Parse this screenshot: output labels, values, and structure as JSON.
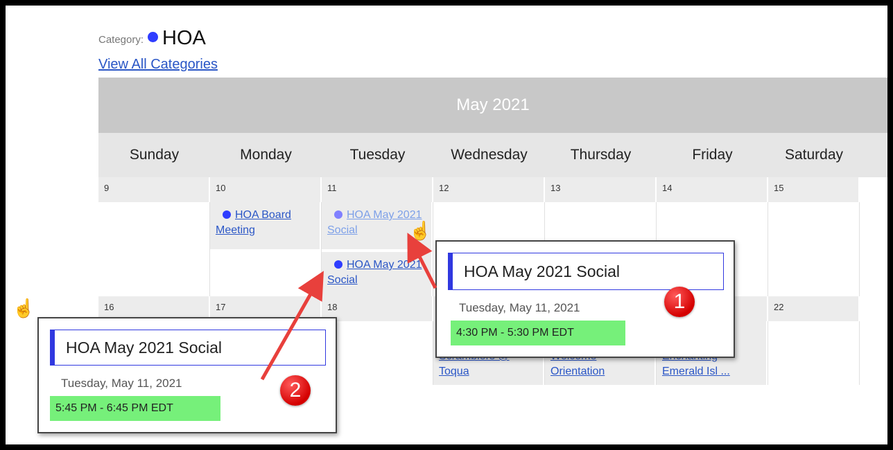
{
  "category": {
    "label": "Category:",
    "name": "HOA",
    "color": "#2f3dff"
  },
  "view_all_link": "View All Categories",
  "calendar": {
    "month_title": "May 2021",
    "weekdays": [
      "Sunday",
      "Monday",
      "Tuesday",
      "Wednesday",
      "Thursday",
      "Friday",
      "Saturday"
    ],
    "week1": {
      "days": [
        "9",
        "10",
        "11",
        "12",
        "13",
        "14",
        "15"
      ],
      "events": {
        "monday": "HOA Board Meeting",
        "tuesday_1": "HOA May 2021 Social",
        "tuesday_2": "HOA May 2021 Social"
      }
    },
    "week2": {
      "days": [
        "16",
        "17",
        "18",
        "",
        "",
        "",
        "22"
      ],
      "events": {
        "wednesday_tail_1": "Scramblers @",
        "wednesday_tail_2": "Toqua",
        "thursday_tail_1": "Welcome",
        "thursday_tail_2": "Orientation",
        "friday_tail_1": "Enchanting",
        "friday_tail_2": "Emerald Isl ..."
      }
    }
  },
  "popup1": {
    "title": "HOA May 2021 Social",
    "date": "Tuesday, May 11, 2021",
    "time": "4:30 PM - 5:30 PM EDT",
    "badge": "1"
  },
  "popup2": {
    "title": "HOA May 2021 Social",
    "date": "Tuesday, May 11, 2021",
    "time": "5:45 PM - 6:45 PM EDT",
    "badge": "2"
  },
  "colors": {
    "accent": "#3038e0",
    "time_bg": "#76f07a",
    "arrow": "#e8403c",
    "link": "#2a56c6"
  }
}
